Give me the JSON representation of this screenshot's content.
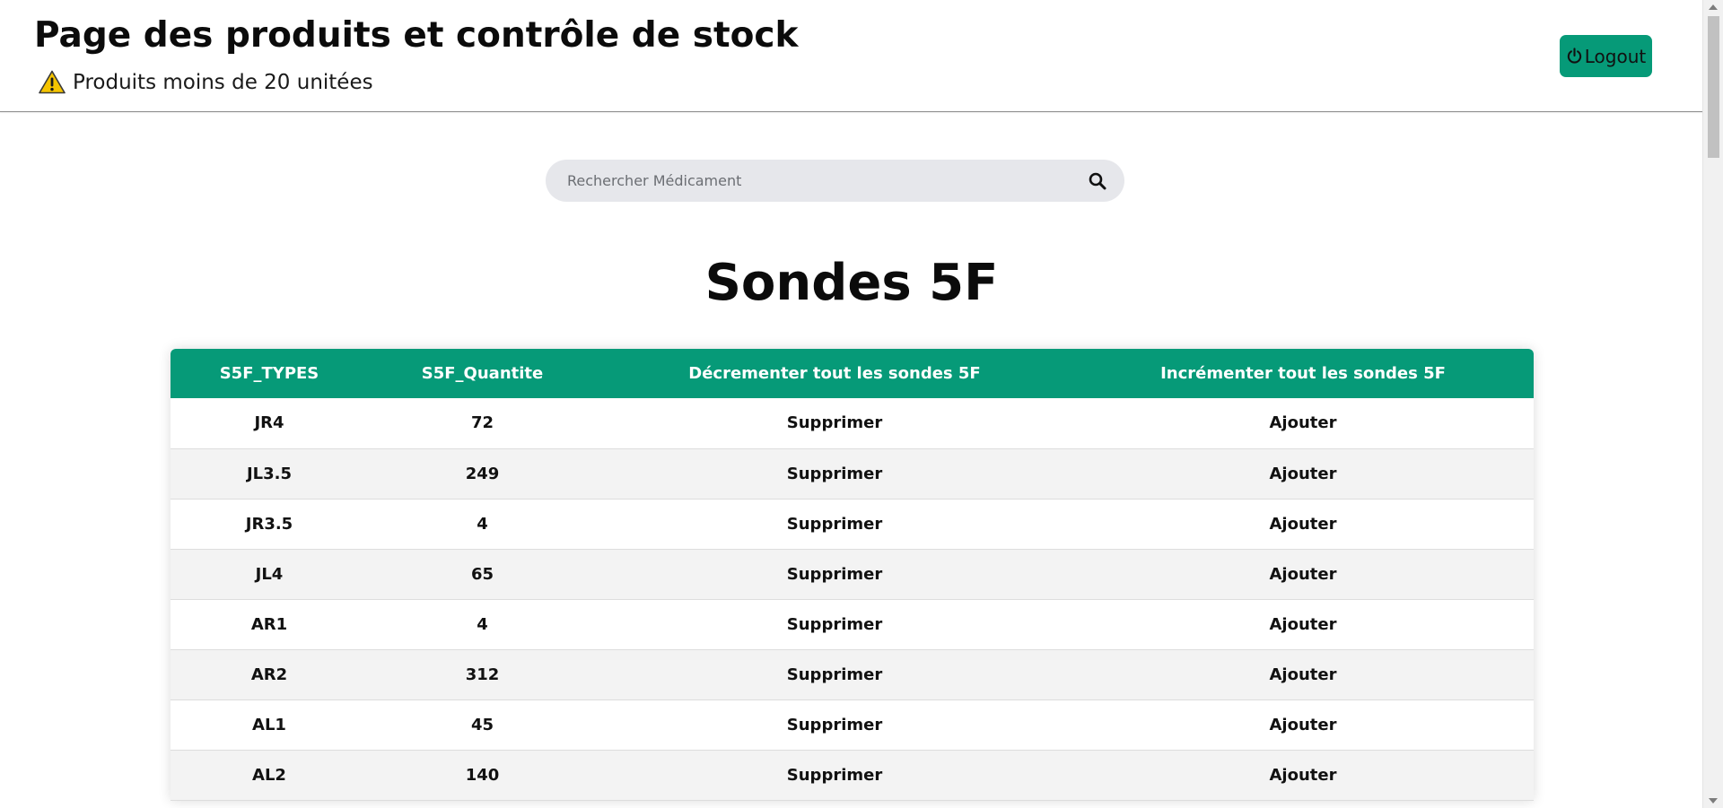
{
  "header": {
    "title": "Page des produits et contrôle de stock",
    "alert_label": "Produits moins de 20 unitées",
    "alert_icon": "warning-icon",
    "logout_label": "Logout",
    "logout_icon": "power-icon"
  },
  "search": {
    "placeholder": "Rechercher Médicament",
    "value": "",
    "icon": "search-icon"
  },
  "section": {
    "title": "Sondes 5F"
  },
  "table": {
    "headers": [
      "S5F_TYPES",
      "S5F_Quantite",
      "Décrementer tout les sondes 5F",
      "Incrémenter tout les sondes 5F"
    ],
    "rows": [
      {
        "type": "JR4",
        "quantite": "72",
        "decrement": "Supprimer",
        "increment": "Ajouter"
      },
      {
        "type": "JL3.5",
        "quantite": "249",
        "decrement": "Supprimer",
        "increment": "Ajouter"
      },
      {
        "type": "JR3.5",
        "quantite": "4",
        "decrement": "Supprimer",
        "increment": "Ajouter"
      },
      {
        "type": "JL4",
        "quantite": "65",
        "decrement": "Supprimer",
        "increment": "Ajouter"
      },
      {
        "type": "AR1",
        "quantite": "4",
        "decrement": "Supprimer",
        "increment": "Ajouter"
      },
      {
        "type": "AR2",
        "quantite": "312",
        "decrement": "Supprimer",
        "increment": "Ajouter"
      },
      {
        "type": "AL1",
        "quantite": "45",
        "decrement": "Supprimer",
        "increment": "Ajouter"
      },
      {
        "type": "AL2",
        "quantite": "140",
        "decrement": "Supprimer",
        "increment": "Ajouter"
      }
    ]
  },
  "colors": {
    "accent": "#069a78",
    "row_alt": "#f3f3f3",
    "search_bg": "#e6e7eb",
    "warning": "#f5c400"
  }
}
